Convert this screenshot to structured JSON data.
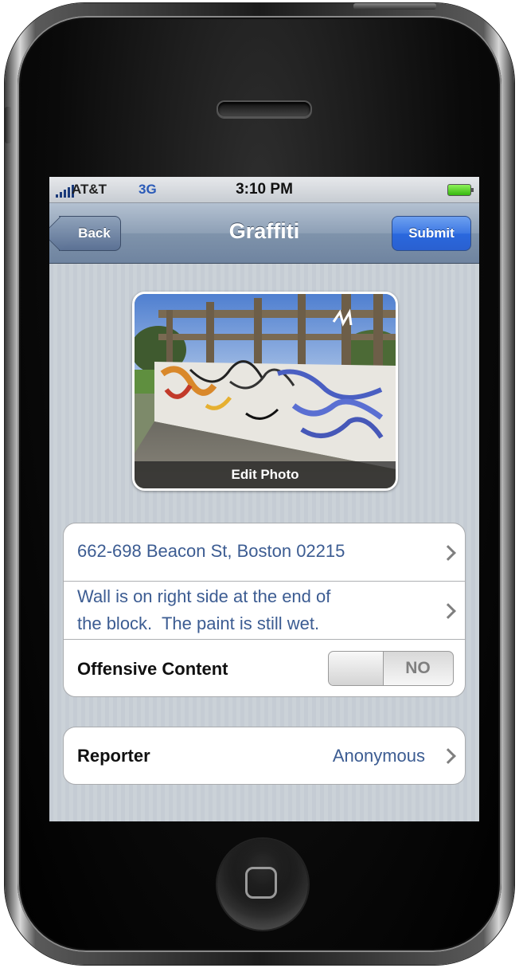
{
  "status_bar": {
    "carrier": "AT&T",
    "network": "3G",
    "time": "3:10 PM"
  },
  "nav_bar": {
    "back_label": "Back",
    "title": "Graffiti",
    "submit_label": "Submit"
  },
  "photo": {
    "caption": "Edit Photo"
  },
  "report": {
    "address": "662-698 Beacon St, Boston 02215",
    "description_line1": "Wall is on right side at the end of",
    "description_line2": "the block.  The paint is still wet.",
    "offensive_label": "Offensive Content",
    "offensive_value": "NO"
  },
  "reporter": {
    "label": "Reporter",
    "value": "Anonymous"
  },
  "colors": {
    "nav_bar": "#7f93ab",
    "submit_blue": "#2a68de",
    "value_text": "#3c5c92",
    "background_stripes": "#c5ccd4"
  }
}
